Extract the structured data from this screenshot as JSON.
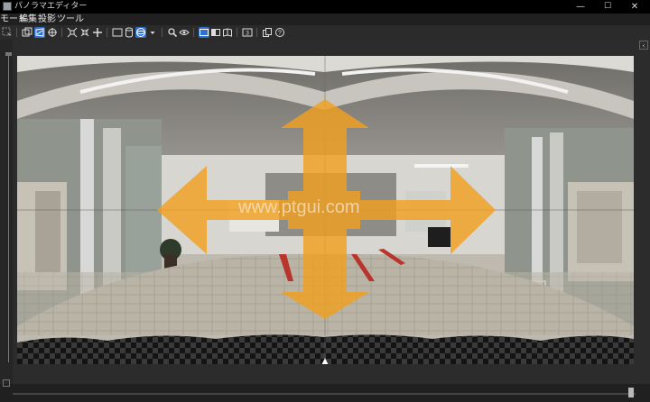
{
  "window": {
    "title": "パノラマエディター",
    "controls": {
      "minimize": "—",
      "maximize": "☐",
      "close": "✕"
    }
  },
  "menu": {
    "items": [
      "モード",
      "編集",
      "投影",
      "ツール"
    ]
  },
  "toolbar": {
    "groups": [
      [
        "select-tool"
      ],
      [
        "layers-tool",
        "free-view-tool",
        "move-tool"
      ],
      [
        "fit-tool",
        "shrink-tool",
        "cross-move-tool"
      ],
      [
        "rectangle-tool",
        "cylinder-tool",
        "sphere-tool",
        "dropdown"
      ],
      [
        "search-tool",
        "eye-tool"
      ],
      [
        "view-flat",
        "view-split",
        "view-book"
      ],
      [
        "number-3"
      ],
      [
        "copy-tool",
        "help-tool"
      ]
    ],
    "active": [
      "free-view-tool",
      "sphere-tool",
      "view-flat"
    ],
    "accent": "#2f6fd0"
  },
  "viewer": {
    "watermark": "www.ptgui.com",
    "overlay_color": "#f0a020",
    "horizon_marker": "▲"
  },
  "panel": {
    "collapse_label": "‹"
  }
}
